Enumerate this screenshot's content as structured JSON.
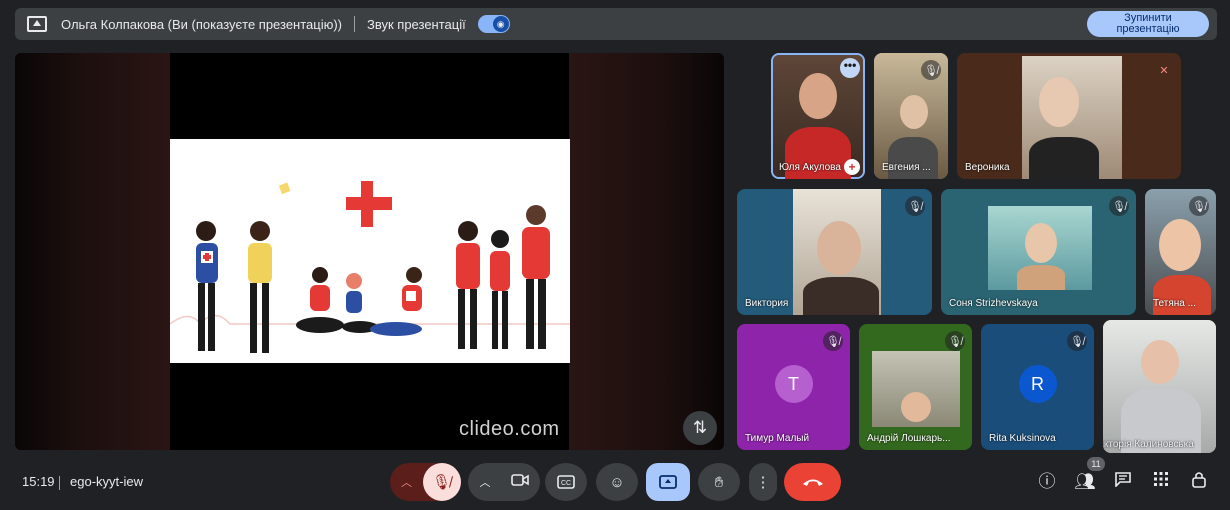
{
  "topbar": {
    "presenter": "Ольга Колпакова (Ви (показуєте презентацію))",
    "sound_label": "Звук презентації",
    "stop_button": "Зупинити\nпрезентацію"
  },
  "stage": {
    "watermark": "clideo.com"
  },
  "participants": [
    {
      "name": "Юля Акулова"
    },
    {
      "name": "Евгения ..."
    },
    {
      "name": "Вероника"
    },
    {
      "name": "Виктория"
    },
    {
      "name": "Соня Strizhevskaya"
    },
    {
      "name": "Тетяна ..."
    },
    {
      "name": "Тимур Малый",
      "letter": "T"
    },
    {
      "name": "Андрій Лошкарь..."
    },
    {
      "name": "Rita Kuksinova",
      "letter": "R"
    },
    {
      "name": "Вікторія Калиновська"
    }
  ],
  "bottom": {
    "time": "15:19",
    "meeting_code": "ego-kyyt-iew",
    "people_count": "11"
  },
  "colors": {
    "accent": "#a8c7fa",
    "end_call": "#ea4335",
    "tile_purple": "#8e24aa",
    "tile_blue": "#1a4d7a"
  }
}
